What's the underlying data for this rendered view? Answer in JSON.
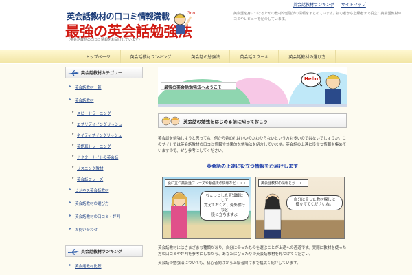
{
  "header": {
    "subtitle": "英会話教材の口コミ情報満載",
    "title": "最強の英会話勉強法",
    "description": "（英会話教材の口コミ情報をお届けしています）",
    "links": [
      "英会話教材ランキング",
      "サイトマップ"
    ],
    "intro": "英会話を身につけるための教材や勉強法の情報をまとめています。初心者から上級者まで役立つ英会話教材の口コミやレビューを紹介しています。"
  },
  "gnav": [
    "トップページ",
    "英会話教材ランキング",
    "英会話の勉強法",
    "英会話スクール",
    "英会話教材の選び方"
  ],
  "sidebar": {
    "heading1": "英会話教材カテゴリー",
    "items1": [
      {
        "label": "英会話教材一覧",
        "sub": false
      },
      {
        "label": "英会話教材",
        "sub": false
      },
      {
        "label": "スピードラーニング",
        "sub": true
      },
      {
        "label": "エブリデイイングリッシュ",
        "sub": true
      },
      {
        "label": "ネイティブイングリッシュ",
        "sub": true
      },
      {
        "label": "英語耳トレーニング",
        "sub": true
      },
      {
        "label": "ドクターナイトの英会話",
        "sub": true
      },
      {
        "label": "リスニング教材",
        "sub": true
      },
      {
        "label": "英会話フレーズ",
        "sub": true
      },
      {
        "label": "ビジネス英会話教材",
        "sub": false
      },
      {
        "label": "英会話教材の選び方",
        "sub": false
      },
      {
        "label": "英会話教材の口コミ・評判",
        "sub": false
      },
      {
        "label": "お問い合わせ",
        "sub": false
      }
    ],
    "heading2": "英会話教材ランキング",
    "items2": [
      {
        "label": "英会話教材比較",
        "sub": false
      }
    ]
  },
  "main": {
    "hero_title": "最強の英会話勉強法へようこそ",
    "hero_bubble": "Hello!",
    "section_title": "英会話の勉強をはじめる前に知っておこう",
    "intro_text": "英会話を勉強しようと思っても、何から始めればいいのかわからないという方も多いのではないでしょうか。このサイトでは英会話教材の口コミ情報や効果的な勉強法を紹介しています。英会話の上達に役立つ情報を集めていますので、ぜひ参考にしてください。",
    "mid_title": "英会話の上達に役立つ情報をお届けします",
    "comic1": {
      "caption": "役に立つ英会話フレーズや勉強法の情報など・・・",
      "bubble": "ちょっとした豆知識として\n覚えておくと、海外旅行など\n役に立ちますよ"
    },
    "comic2": {
      "caption": "英会話教材の情報とか・・・",
      "bubble": "自分に合った教材探しに\n役立ててくださいね。"
    },
    "outro_text": "英会話教材にはさまざまな種類があり、自分に合ったものを選ぶことが上達への近道です。実際に教材を使った方の口コミや評判を参考にしながら、あなたにぴったりの英会話教材を見つけてください。",
    "outro_text2": "英会話の勉強法についても、初心者向けから上級者向けまで幅広く紹介しています。"
  },
  "colors": {
    "title_red": "#d01810",
    "link_blue": "#224488",
    "nav_bg": "#f6eeb8"
  }
}
